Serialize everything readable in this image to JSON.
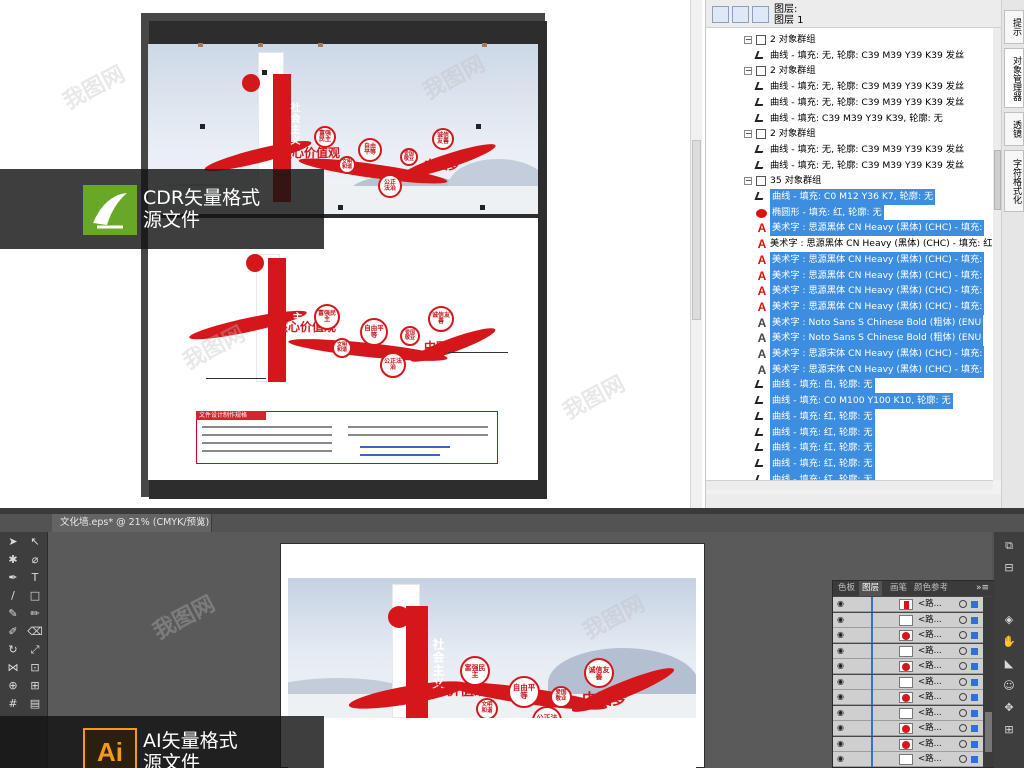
{
  "cdr_banner": {
    "line1": "CDR矢量格式",
    "line2": "源文件"
  },
  "ai_banner": {
    "logo": "Ai",
    "line1": "AI矢量格式",
    "line2": "源文件"
  },
  "artwork": {
    "vertical_title_1": "社会主义",
    "calligraphy": "核心价值观",
    "circles": [
      "富强民主",
      "自由平等",
      "诚信友善",
      "爱国敬业",
      "文明和谐",
      "公正法治"
    ],
    "china_dream": "中国梦",
    "doc_box_title": "文件设计制作规格"
  },
  "object_manager": {
    "layer_title_1": "图层:",
    "layer_title_2": "图层 1",
    "rows": [
      {
        "text": "2 对象群组",
        "icon": "group-icon",
        "indent": 1,
        "selected": false
      },
      {
        "text": "曲线 - 填充: 无, 轮廓: C39 M39 Y39 K39 发丝",
        "icon": "curve-icon",
        "indent": 2,
        "selected": false
      },
      {
        "text": "2 对象群组",
        "icon": "group-icon",
        "indent": 1,
        "selected": false
      },
      {
        "text": "曲线 - 填充: 无, 轮廓: C39 M39 Y39 K39 发丝",
        "icon": "curve-icon",
        "indent": 2,
        "selected": false
      },
      {
        "text": "曲线 - 填充: 无, 轮廓: C39 M39 Y39 K39 发丝",
        "icon": "curve-icon",
        "indent": 2,
        "selected": false
      },
      {
        "text": "曲线 - 填充: C39 M39 Y39 K39, 轮廓: 无",
        "icon": "curve-icon",
        "indent": 2,
        "selected": false
      },
      {
        "text": "2 对象群组",
        "icon": "group-icon",
        "indent": 1,
        "selected": false
      },
      {
        "text": "曲线 - 填充: 无, 轮廓: C39 M39 Y39 K39 发丝",
        "icon": "curve-icon",
        "indent": 2,
        "selected": false
      },
      {
        "text": "曲线 - 填充: 无, 轮廓: C39 M39 Y39 K39 发丝",
        "icon": "curve-icon",
        "indent": 2,
        "selected": false
      },
      {
        "text": "35 对象群组",
        "icon": "group-icon",
        "indent": 1,
        "selected": false
      },
      {
        "text": "曲线 - 填充: C0 M12 Y36 K7, 轮廓: 无",
        "icon": "curve-icon",
        "indent": 2,
        "selected": true
      },
      {
        "text": "椭圆形 - 填充: 红, 轮廓: 无",
        "icon": "ellipse-icon",
        "indent": 2,
        "selected": true
      },
      {
        "text": "美术字 : 思源黑体 CN Heavy (黑体) (CHC) - 填充:",
        "icon": "artistic-text-icon",
        "indent": 2,
        "selected": true
      },
      {
        "text": "美术字 : 思源黑体 CN Heavy (黑体) (CHC) - 填充: 红, 轮廓",
        "icon": "artistic-text-icon",
        "indent": 2,
        "selected": false
      },
      {
        "text": "美术字 : 思源黑体 CN Heavy (黑体) (CHC) - 填充:",
        "icon": "artistic-text-icon",
        "indent": 2,
        "selected": true
      },
      {
        "text": "美术字 : 思源黑体 CN Heavy (黑体) (CHC) - 填充:",
        "icon": "artistic-text-icon",
        "indent": 2,
        "selected": true
      },
      {
        "text": "美术字 : 思源黑体 CN Heavy (黑体) (CHC) - 填充:",
        "icon": "artistic-text-icon",
        "indent": 2,
        "selected": true
      },
      {
        "text": "美术字 : 思源黑体 CN Heavy (黑体) (CHC) - 填充:",
        "icon": "artistic-text-icon",
        "indent": 2,
        "selected": true
      },
      {
        "text": "美术字 : Noto Sans S Chinese Bold (粗体) (ENU",
        "icon": "artistic-text-icon",
        "indent": 2,
        "selected": true
      },
      {
        "text": "美术字 : Noto Sans S Chinese Bold (粗体) (ENU",
        "icon": "artistic-text-icon",
        "indent": 2,
        "selected": true
      },
      {
        "text": "美术字 : 思源宋体 CN Heavy (黑体) (CHC) - 填充:",
        "icon": "artistic-text-icon",
        "indent": 2,
        "selected": true
      },
      {
        "text": "美术字 : 思源宋体 CN Heavy (黑体) (CHC) - 填充:",
        "icon": "artistic-text-icon",
        "indent": 2,
        "selected": true
      },
      {
        "text": "曲线 - 填充: 白, 轮廓: 无",
        "icon": "curve-icon",
        "indent": 2,
        "selected": true
      },
      {
        "text": "曲线 - 填充: C0 M100 Y100 K10, 轮廓: 无",
        "icon": "curve-icon",
        "indent": 2,
        "selected": true
      },
      {
        "text": "曲线 - 填充: 红, 轮廓: 无",
        "icon": "curve-icon",
        "indent": 2,
        "selected": true
      },
      {
        "text": "曲线 - 填充: 红, 轮廓: 无",
        "icon": "curve-icon",
        "indent": 2,
        "selected": true
      },
      {
        "text": "曲线 - 填充: 红, 轮廓: 无",
        "icon": "curve-icon",
        "indent": 2,
        "selected": true
      },
      {
        "text": "曲线 - 填充: 红, 轮廓: 无",
        "icon": "curve-icon",
        "indent": 2,
        "selected": true
      },
      {
        "text": "曲线 - 填充: 红, 轮廓: 无",
        "icon": "curve-icon",
        "indent": 2,
        "selected": true
      },
      {
        "text": "曲线 - 填充: 红, 轮廓: 无",
        "icon": "curve-icon",
        "indent": 2,
        "selected": true
      }
    ],
    "side_tabs": [
      "提示",
      "对象管理器",
      "透镜",
      "字符格式化"
    ]
  },
  "illustrator": {
    "doc_tab": "文化墙.eps* @ 21% (CMYK/预览)",
    "layers_tabs": [
      "色板",
      "图层",
      "画笔",
      "颜色参考"
    ],
    "layer_rows": [
      {
        "name": "<路...",
        "thumb": "flag"
      },
      {
        "name": "<路...",
        "thumb": "blank"
      },
      {
        "name": "<路...",
        "thumb": "dot"
      },
      {
        "name": "<路...",
        "thumb": "blank"
      },
      {
        "name": "<路...",
        "thumb": "dot"
      },
      {
        "name": "<路...",
        "thumb": "blank"
      },
      {
        "name": "<路...",
        "thumb": "dot"
      },
      {
        "name": "<路...",
        "thumb": "blank"
      },
      {
        "name": "<路...",
        "thumb": "dot"
      },
      {
        "name": "<路...",
        "thumb": "dot"
      },
      {
        "name": "<路...",
        "thumb": "blank"
      }
    ]
  },
  "colors": {
    "accent_red": "#d5171b",
    "selection_blue": "#3d8ee0",
    "cdr_green": "#69a826",
    "ai_orange": "#f39c12"
  }
}
